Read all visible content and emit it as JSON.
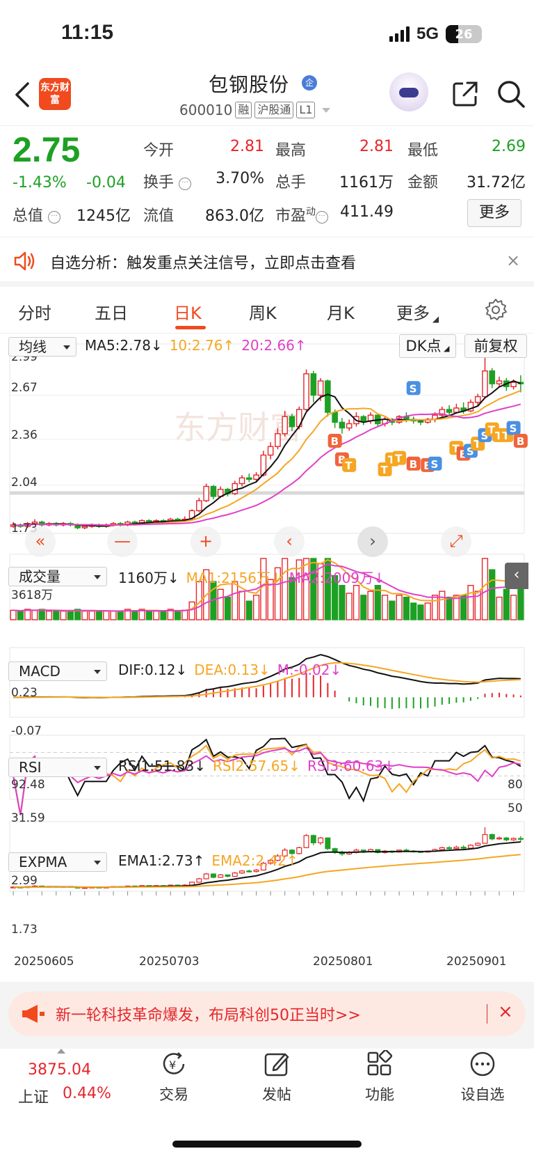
{
  "status": {
    "time": "11:15",
    "network": "5G",
    "battery": "26"
  },
  "header": {
    "app_logo": "东方财富",
    "stock_name": "包钢股份",
    "badge": "企",
    "code": "600010",
    "tags": [
      "融",
      "沪股通",
      "L1"
    ]
  },
  "quote": {
    "price": "2.75",
    "change_pct": "-1.43%",
    "change_abs": "-0.04",
    "open_label": "今开",
    "open": "2.81",
    "high_label": "最高",
    "high": "2.81",
    "low_label": "最低",
    "low": "2.69",
    "turnover_label": "换手",
    "turnover": "3.70%",
    "volume_label": "总手",
    "volume": "1161万",
    "amount_label": "金额",
    "amount": "31.72亿",
    "mktcap_label": "总值",
    "mktcap": "1245亿",
    "float_label": "流值",
    "float": "863.0亿",
    "pe_label": "市盈",
    "pe_sup": "动",
    "pe": "411.49",
    "more_label": "更多"
  },
  "notice": {
    "text": "自选分析：触发重点关注信号，立即点击查看",
    "close": "×"
  },
  "tabs": [
    "分时",
    "五日",
    "日K",
    "周K",
    "月K",
    "更多"
  ],
  "kline": {
    "indicator": "均线",
    "ma5": "MA5:2.78↓",
    "ma10": "10:2.76↑",
    "ma20": "20:2.66↑",
    "dk_label": "DK点",
    "fq_label": "前复权",
    "y_labels": [
      "2.99",
      "2.67",
      "2.36",
      "2.04",
      "1.73"
    ],
    "watermark": "东方财富"
  },
  "volume": {
    "indicator": "成交量",
    "vol": "1160万↓",
    "ma1": "MA1:2156万↓",
    "ma2": "MA2:2009万↓",
    "max_label": "3618万"
  },
  "macd": {
    "indicator": "MACD",
    "dif": "DIF:0.12↓",
    "dea": "DEA:0.13↓",
    "m": "M:-0.02↓",
    "top": "0.23",
    "bottom": "-0.07"
  },
  "rsi": {
    "indicator": "RSI",
    "rsi1": "RSI1:51.83↓",
    "rsi2": "RSI2:57.65↓",
    "rsi3": "RSI3:60.63↓",
    "top": "92.48",
    "bottom": "31.59",
    "r80": "80",
    "r50": "50"
  },
  "expma": {
    "indicator": "EXPMA",
    "ema1": "EMA1:2.73↑",
    "ema2": "EMA2:2.42↑",
    "top": "2.99",
    "bottom": "1.73"
  },
  "dates": [
    "20250605",
    "20250703",
    "20250801",
    "20250901"
  ],
  "promo": {
    "text": "新一轮科技革命爆发，布局科创50正当时>>",
    "close": "×"
  },
  "bottom_nav": {
    "index_value": "3875.04",
    "index_name": "上证",
    "index_pct": "0.44%",
    "items": [
      "交易",
      "发帖",
      "功能",
      "设自选"
    ]
  },
  "colors": {
    "up": "#e5262b",
    "down": "#1ea024",
    "brand": "#f04a1e",
    "ma10": "#f5a623",
    "ma20": "#e040c8"
  },
  "chart_data": {
    "type": "candlestick",
    "description_source": "daily K-line, values estimated from y-axis",
    "ylim": [
      1.73,
      2.99
    ],
    "candles": [
      [
        1.75,
        1.76,
        1.78,
        1.74
      ],
      [
        1.76,
        1.75,
        1.77,
        1.74
      ],
      [
        1.75,
        1.77,
        1.78,
        1.74
      ],
      [
        1.77,
        1.78,
        1.8,
        1.76
      ],
      [
        1.78,
        1.76,
        1.79,
        1.75
      ],
      [
        1.76,
        1.77,
        1.78,
        1.75
      ],
      [
        1.77,
        1.76,
        1.78,
        1.75
      ],
      [
        1.76,
        1.77,
        1.78,
        1.75
      ],
      [
        1.77,
        1.76,
        1.78,
        1.75
      ],
      [
        1.76,
        1.74,
        1.77,
        1.73
      ],
      [
        1.74,
        1.75,
        1.76,
        1.73
      ],
      [
        1.75,
        1.76,
        1.77,
        1.74
      ],
      [
        1.76,
        1.75,
        1.77,
        1.74
      ],
      [
        1.75,
        1.76,
        1.77,
        1.74
      ],
      [
        1.76,
        1.77,
        1.78,
        1.75
      ],
      [
        1.77,
        1.76,
        1.78,
        1.75
      ],
      [
        1.76,
        1.78,
        1.79,
        1.75
      ],
      [
        1.78,
        1.77,
        1.79,
        1.76
      ],
      [
        1.77,
        1.79,
        1.8,
        1.76
      ],
      [
        1.79,
        1.78,
        1.8,
        1.77
      ],
      [
        1.78,
        1.79,
        1.8,
        1.77
      ],
      [
        1.79,
        1.78,
        1.8,
        1.77
      ],
      [
        1.78,
        1.8,
        1.81,
        1.77
      ],
      [
        1.8,
        1.79,
        1.81,
        1.78
      ],
      [
        1.79,
        1.8,
        1.82,
        1.78
      ],
      [
        1.8,
        1.86,
        1.87,
        1.79
      ],
      [
        1.86,
        1.93,
        1.95,
        1.85
      ],
      [
        1.93,
        2.03,
        2.05,
        1.92
      ],
      [
        2.03,
        1.96,
        2.04,
        1.94
      ],
      [
        1.96,
        2.01,
        2.03,
        1.95
      ],
      [
        2.01,
        1.98,
        2.02,
        1.96
      ],
      [
        1.98,
        2.05,
        2.07,
        1.97
      ],
      [
        2.05,
        2.09,
        2.11,
        2.03
      ],
      [
        2.09,
        2.08,
        2.12,
        2.06
      ],
      [
        2.08,
        2.11,
        2.13,
        2.06
      ],
      [
        2.11,
        2.25,
        2.28,
        2.1
      ],
      [
        2.25,
        2.31,
        2.34,
        2.22
      ],
      [
        2.31,
        2.4,
        2.44,
        2.29
      ],
      [
        2.4,
        2.52,
        2.56,
        2.38
      ],
      [
        2.52,
        2.45,
        2.54,
        2.42
      ],
      [
        2.45,
        2.57,
        2.59,
        2.43
      ],
      [
        2.57,
        2.82,
        2.85,
        2.56
      ],
      [
        2.82,
        2.67,
        2.84,
        2.62
      ],
      [
        2.67,
        2.77,
        2.79,
        2.63
      ],
      [
        2.77,
        2.55,
        2.78,
        2.52
      ],
      [
        2.55,
        2.48,
        2.57,
        2.44
      ],
      [
        2.48,
        2.44,
        2.51,
        2.4
      ],
      [
        2.44,
        2.47,
        2.5,
        2.42
      ],
      [
        2.47,
        2.52,
        2.55,
        2.45
      ],
      [
        2.52,
        2.49,
        2.53,
        2.46
      ],
      [
        2.49,
        2.53,
        2.55,
        2.47
      ],
      [
        2.53,
        2.47,
        2.54,
        2.45
      ],
      [
        2.47,
        2.5,
        2.52,
        2.45
      ],
      [
        2.5,
        2.48,
        2.51,
        2.46
      ],
      [
        2.48,
        2.52,
        2.53,
        2.47
      ],
      [
        2.52,
        2.5,
        2.55,
        2.48
      ],
      [
        2.5,
        2.49,
        2.52,
        2.47
      ],
      [
        2.49,
        2.48,
        2.5,
        2.46
      ],
      [
        2.48,
        2.5,
        2.51,
        2.47
      ],
      [
        2.5,
        2.53,
        2.55,
        2.48
      ],
      [
        2.53,
        2.57,
        2.59,
        2.51
      ],
      [
        2.57,
        2.55,
        2.6,
        2.53
      ],
      [
        2.55,
        2.58,
        2.61,
        2.54
      ],
      [
        2.58,
        2.56,
        2.62,
        2.54
      ],
      [
        2.56,
        2.62,
        2.64,
        2.55
      ],
      [
        2.62,
        2.66,
        2.68,
        2.6
      ],
      [
        2.66,
        2.84,
        2.99,
        2.65
      ],
      [
        2.84,
        2.75,
        2.86,
        2.72
      ],
      [
        2.75,
        2.77,
        2.8,
        2.73
      ],
      [
        2.77,
        2.73,
        2.79,
        2.7
      ],
      [
        2.73,
        2.76,
        2.78,
        2.71
      ],
      [
        2.76,
        2.75,
        2.81,
        2.69
      ]
    ]
  }
}
